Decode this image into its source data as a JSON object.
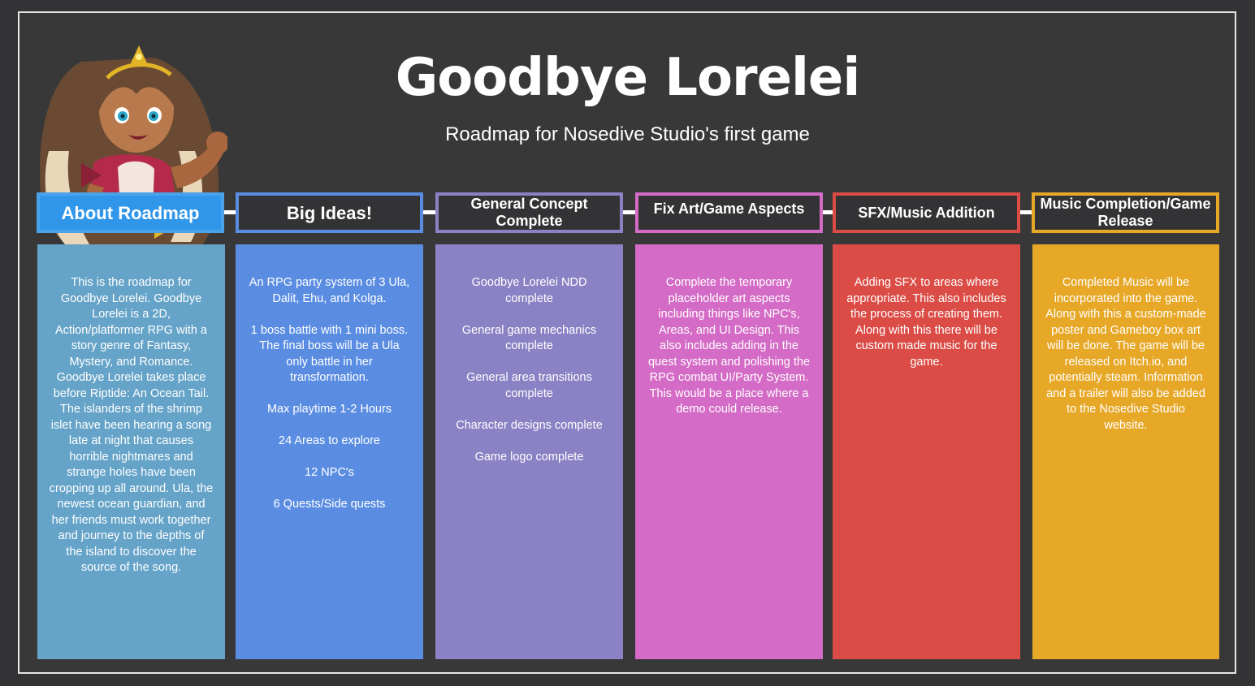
{
  "page": {
    "title": "Goodbye Lorelei",
    "subtitle": "Roadmap for Nosedive Studio's first game"
  },
  "colors": {
    "background": "#333335",
    "board": "#383839",
    "about": "#65A3C8",
    "about_header": "#2F96EA",
    "ideas": "#5A8DE2",
    "concept": "#8A82C4",
    "art": "#D46BC6",
    "sfx": "#DA4C45",
    "release": "#E7A828"
  },
  "columns": [
    {
      "header": "About Roadmap",
      "body": "This is the roadmap for Goodbye Lorelei. Goodbye Lorelei is a 2D, Action/platformer RPG with a story genre of Fantasy, Mystery, and Romance. Goodbye Lorelei takes place before Riptide: An Ocean Tail. The islanders of the shrimp islet have been hearing a song late at night that causes horrible nightmares and strange holes have been cropping up all around. Ula, the newest ocean guardian, and her friends must work together and journey to the depths of the island to discover the source of the song."
    },
    {
      "header": "Big Ideas!",
      "body": "An RPG party system  of 3 Ula, Dalit, Ehu, and Kolga.\n\n1 boss battle with 1 mini boss. The final boss will be a Ula only battle in her transformation.\n\nMax playtime 1-2 Hours\n\n24 Areas to explore\n\n12 NPC's\n\n6 Quests/Side quests"
    },
    {
      "header": "General Concept Complete",
      "body": "Goodbye Lorelei NDD complete\n\nGeneral game mechanics complete\n\nGeneral area transitions complete\n\nCharacter designs complete\n\nGame logo complete"
    },
    {
      "header": "Fix Art/Game Aspects",
      "body": "Complete the temporary placeholder art aspects including things like NPC's, Areas, and UI Design. This also includes adding in the quest system and polishing the RPG combat UI/Party System. This would be a place where a demo could release."
    },
    {
      "header": "SFX/Music Addition",
      "body": "Adding SFX to areas where appropriate. This also includes the process of creating them. Along with this there will be custom made music for the game."
    },
    {
      "header": "Music Completion/Game Release",
      "body": "Completed Music will be incorporated into the game. Along with this a custom-made poster and Gameboy box art will be done. The game will be released on Itch.io, and potentially steam. Information and a trailer will also be added to the Nosedive Studio website."
    }
  ]
}
